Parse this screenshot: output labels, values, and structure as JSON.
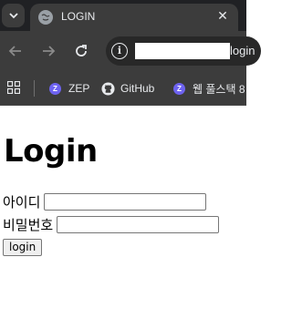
{
  "browser": {
    "tab": {
      "title": "LOGIN",
      "favicon": "globe-icon",
      "close_glyph": "✕"
    },
    "tab_menu_icon": "chevron-down-icon",
    "toolbar": {
      "back": "back-arrow-icon",
      "forward": "forward-arrow-icon",
      "reload": "reload-icon"
    },
    "address": {
      "info_icon": "info-icon",
      "visible_url_fragment": "login"
    },
    "bookmarks": [
      {
        "label": "ZEP",
        "icon": "zep-icon"
      },
      {
        "label": "GitHub",
        "icon": "github-icon"
      },
      {
        "label": "웹 풀스택 8",
        "icon": "zep-icon"
      }
    ],
    "apps_icon": "apps-grid-icon"
  },
  "page": {
    "title": "Login",
    "form": {
      "id_label": "아이디",
      "id_value": "",
      "password_label": "비밀번호",
      "password_value": "",
      "submit_label": "login"
    }
  },
  "colors": {
    "chrome_dark": "#202124",
    "chrome_toolbar": "#3c3c3c",
    "zep_brand": "#6e63f0"
  }
}
